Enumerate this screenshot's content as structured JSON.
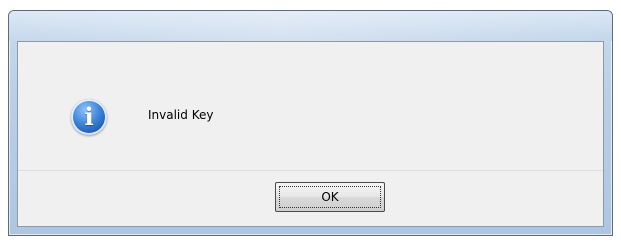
{
  "dialog": {
    "title": "",
    "icon": "info-icon",
    "icon_glyph": "i",
    "message": "Invalid Key",
    "ok_label": "OK"
  },
  "colors": {
    "frame": "#b9cfe6",
    "client": "#f0f0f0",
    "icon_blue": "#3b82d6"
  }
}
